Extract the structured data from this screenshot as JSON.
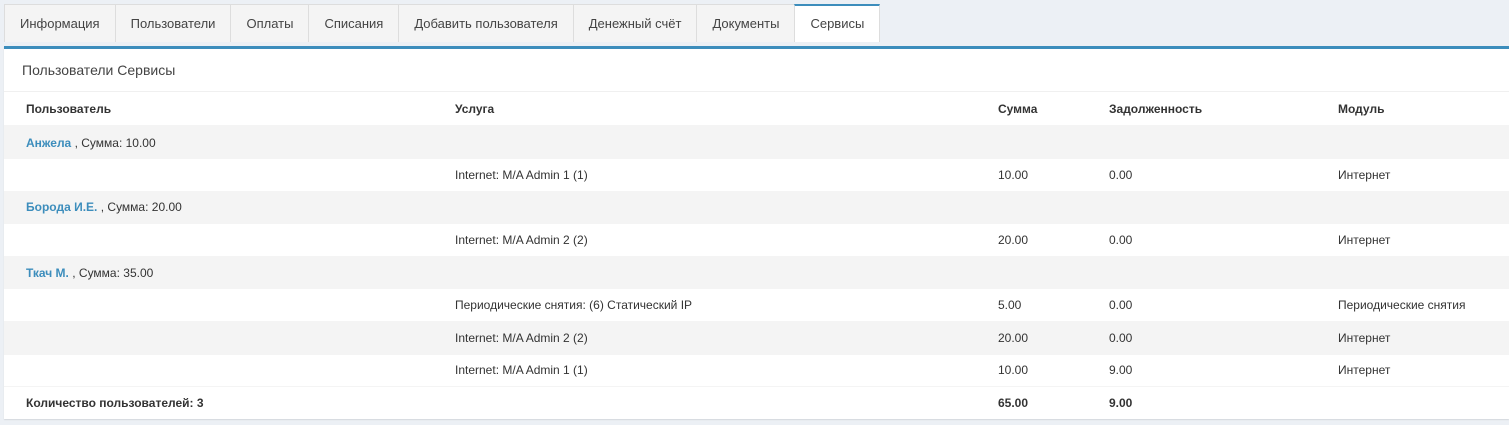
{
  "tabs": [
    {
      "label": "Информация"
    },
    {
      "label": "Пользователи"
    },
    {
      "label": "Оплаты"
    },
    {
      "label": "Списания"
    },
    {
      "label": "Добавить пользователя"
    },
    {
      "label": "Денежный счёт"
    },
    {
      "label": "Документы"
    },
    {
      "label": "Сервисы"
    }
  ],
  "active_tab": "Сервисы",
  "panel": {
    "title": "Пользователи Сервисы"
  },
  "table": {
    "headers": [
      "Пользователь",
      "Услуга",
      "Сумма",
      "Задолженность",
      "Модуль"
    ],
    "groups": [
      {
        "user": "Анжела",
        "summary": ", Сумма: 10.00",
        "rows": [
          {
            "service": "Internet: M/A Admin 1 (1)",
            "sum": "10.00",
            "debt": "0.00",
            "module": "Интернет"
          }
        ]
      },
      {
        "user": "Борода И.Е.",
        "summary": ", Сумма: 20.00",
        "rows": [
          {
            "service": "Internet: M/A Admin 2 (2)",
            "sum": "20.00",
            "debt": "0.00",
            "module": "Интернет"
          }
        ]
      },
      {
        "user": "Ткач М.",
        "summary": ", Сумма: 35.00",
        "rows": [
          {
            "service": "Периодические снятия: (6) Статический IP",
            "sum": "5.00",
            "debt": "0.00",
            "module": "Периодические снятия"
          },
          {
            "service": "Internet: M/A Admin 2 (2)",
            "sum": "20.00",
            "debt": "0.00",
            "module": "Интернет"
          },
          {
            "service": "Internet: M/A Admin 1 (1)",
            "sum": "10.00",
            "debt": "9.00",
            "module": "Интернет"
          }
        ]
      }
    ],
    "footer": {
      "label": "Количество пользователей: 3",
      "sum": "65.00",
      "debt": "9.00"
    }
  },
  "colors": {
    "accent": "#3c8dbc",
    "stripe": "#f4f4f4",
    "background": "#ecf0f5"
  }
}
